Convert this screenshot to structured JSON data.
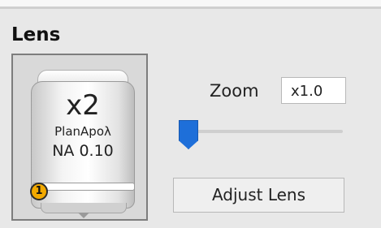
{
  "panel": {
    "title": "Lens"
  },
  "lens": {
    "magnification": "x2",
    "type": "PlanApoλ",
    "aperture": "NA 0.10",
    "badge": "1"
  },
  "zoom": {
    "label": "Zoom",
    "value": "x1.0",
    "slider_level": 0.0
  },
  "actions": {
    "adjust_label": "Adjust Lens"
  },
  "colors": {
    "accent": "#1e6fd9",
    "badge": "#f2a900"
  },
  "icons": {
    "lens_dropdown": "chevron-down-icon"
  }
}
